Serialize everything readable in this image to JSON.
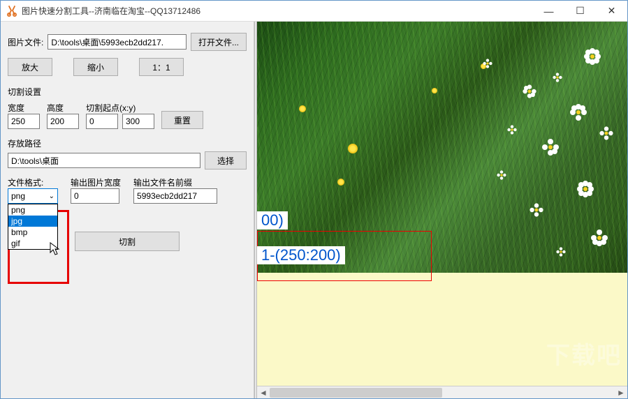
{
  "titlebar": {
    "title": "图片快速分割工具--济南临在淘宝--QQ13712486"
  },
  "file": {
    "label": "图片文件:",
    "path": "D:\\tools\\桌面\\5993ecb2dd217.",
    "open_btn": "打开文件..."
  },
  "zoom": {
    "in": "放大",
    "out": "缩小",
    "reset": "1：1"
  },
  "cut": {
    "group": "切割设置",
    "width_label": "宽度",
    "width": "250",
    "height_label": "高度",
    "height": "200",
    "start_label": "切割起点(x:y)",
    "start_x": "0",
    "start_y": "300",
    "reset_btn": "重置"
  },
  "save": {
    "label": "存放路径",
    "path": "D:\\tools\\桌面",
    "choose_btn": "选择"
  },
  "format": {
    "label": "文件格式:",
    "selected": "png",
    "options": [
      "png",
      "jpg",
      "bmp",
      "gif"
    ],
    "out_width_label": "输出图片宽度",
    "out_width": "0",
    "prefix_label": "输出文件名前缀",
    "prefix": "5993ecb2dd217"
  },
  "action": {
    "cut_btn": "切割"
  },
  "preview": {
    "label_partial": "00)",
    "label1": "1-(250:200)"
  },
  "watermark": "下载吧"
}
